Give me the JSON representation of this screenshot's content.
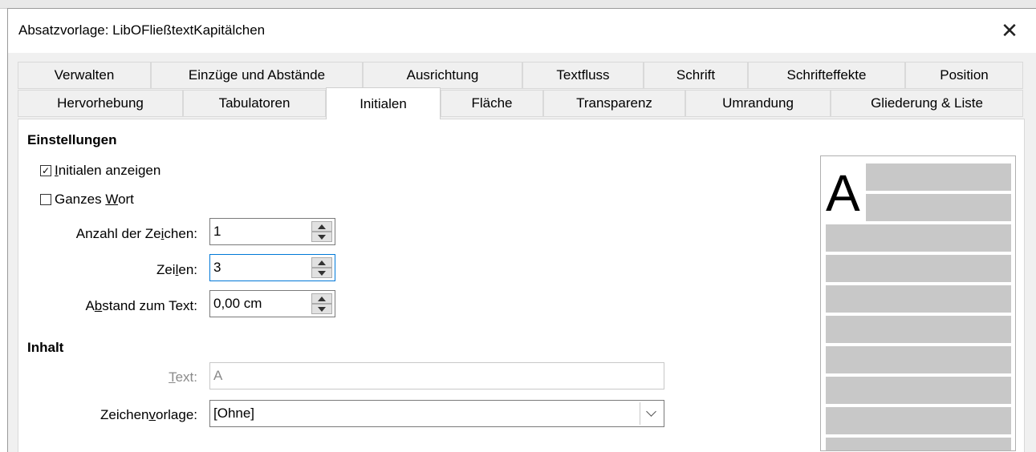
{
  "dialog": {
    "title": "Absatzvorlage: LibOFließtextKapitälchen",
    "close_glyph": "✕"
  },
  "tabs_row1": [
    {
      "label": "Verwalten"
    },
    {
      "label": "Einzüge und Abstände"
    },
    {
      "label": "Ausrichtung"
    },
    {
      "label": "Textfluss"
    },
    {
      "label": "Schrift"
    },
    {
      "label": "Schrifteffekte"
    },
    {
      "label": "Position"
    }
  ],
  "tabs_row2": [
    {
      "label": "Hervorhebung"
    },
    {
      "label": "Tabulatoren"
    },
    {
      "label": "Initialen",
      "active": true
    },
    {
      "label": "Fläche"
    },
    {
      "label": "Transparenz"
    },
    {
      "label": "Umrandung"
    },
    {
      "label": "Gliederung & Liste"
    }
  ],
  "settings": {
    "heading": "Einstellungen",
    "show_dropcaps": {
      "label_before": "",
      "label_mnemonic": "I",
      "label_after": "nitialen anzeigen",
      "checked": true,
      "check_glyph": "✓"
    },
    "whole_word": {
      "label_before": "Ganzes ",
      "label_mnemonic": "W",
      "label_after": "ort",
      "checked": false
    },
    "num_chars": {
      "label_before": "Anzahl der Ze",
      "label_mnemonic": "i",
      "label_after": "chen:",
      "value": "1"
    },
    "lines": {
      "label_before": "Zei",
      "label_mnemonic": "l",
      "label_after": "en:",
      "value": "3"
    },
    "spacing": {
      "label_before": "A",
      "label_mnemonic": "b",
      "label_after": "stand zum Text:",
      "value": "0,00 cm"
    }
  },
  "contents": {
    "heading": "Inhalt",
    "text": {
      "label_before": "",
      "label_mnemonic": "T",
      "label_after": "ext:",
      "value": "A",
      "disabled": true
    },
    "char_style": {
      "label_before": "Zeichen",
      "label_mnemonic": "v",
      "label_after": "orlage:",
      "value": "[Ohne]"
    }
  },
  "preview": {
    "dropcap_letter": "A"
  }
}
